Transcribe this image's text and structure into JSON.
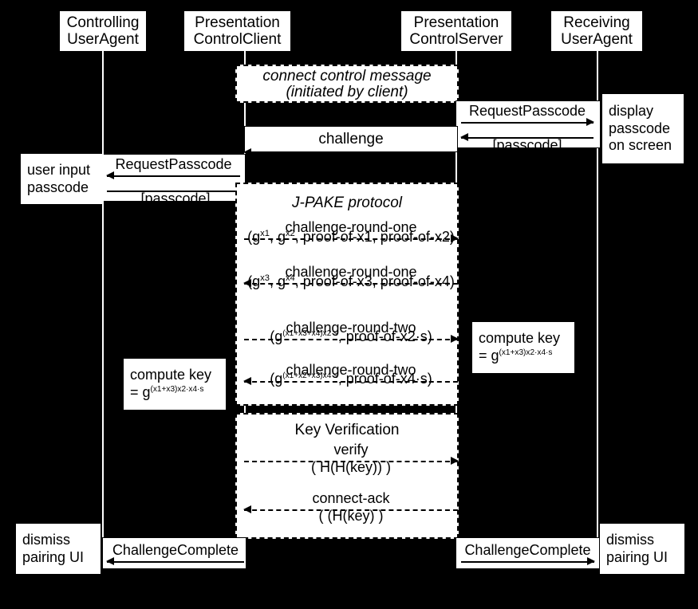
{
  "actors": [
    {
      "id": "controlling-user-agent",
      "line1": "Controlling",
      "line2": "UserAgent"
    },
    {
      "id": "presentation-control-client",
      "line1": "Presentation",
      "line2": "ControlClient"
    },
    {
      "id": "presentation-control-server",
      "line1": "Presentation",
      "line2": "ControlServer"
    },
    {
      "id": "receiving-user-agent",
      "line1": "Receiving",
      "line2": "UserAgent"
    }
  ],
  "frames": {
    "connect": {
      "title_line1": "connect control message",
      "title_line2": "(initiated by client)"
    },
    "challenge": {
      "title": "challenge"
    },
    "jpake": {
      "title": "J-PAKE protocol"
    },
    "keyverif": {
      "title": "Key Verification"
    }
  },
  "notes": {
    "display_passcode": {
      "line1": "display",
      "line2": "passcode",
      "line3": "on screen"
    },
    "user_input_passcode": {
      "line1": "user input",
      "line2": "passcode"
    },
    "compute_key_client": {
      "line1": "compute key",
      "line2_prefix": "= g",
      "line2_exp": "(x1+x3)x2·x4·s"
    },
    "compute_key_server": {
      "line1": "compute key",
      "line2_prefix": "= g",
      "line2_exp": "(x1+x3)x2·x4·s"
    },
    "dismiss_pairing_client": {
      "line1": "dismiss",
      "line2": "pairing UI"
    },
    "dismiss_pairing_server": {
      "line1": "dismiss",
      "line2": "pairing UI"
    }
  },
  "messages": {
    "request_passcode_server": {
      "label": "RequestPasscode"
    },
    "passcode_server": {
      "label": "[passcode]"
    },
    "request_passcode_client": {
      "label": "RequestPasscode"
    },
    "passcode_client": {
      "label": "[passcode]"
    },
    "challenge_round_one_a": {
      "label": "challenge-round-one",
      "payload_pre": "(g",
      "payload_exp1": "x1",
      "payload_mid": ", g",
      "payload_exp2": "x2",
      "payload_post": ", proof-of-x1, proof-of-x2)"
    },
    "challenge_round_one_b": {
      "label": "challenge-round-one",
      "payload_pre": "(g",
      "payload_exp1": "x3",
      "payload_mid": ", g",
      "payload_exp2": "x4",
      "payload_post": ", proof-of-x3, proof-of-x4)"
    },
    "challenge_round_two_a": {
      "label": "challenge-round-two",
      "payload_pre": "(g",
      "payload_exp": "(x1+x3+x4)x2·s",
      "payload_post": ", proof-of-x2·s)"
    },
    "challenge_round_two_b": {
      "label": "challenge-round-two",
      "payload_pre": "(g",
      "payload_exp": "(x1+x2+x3)x4·s",
      "payload_post": ", proof-of-x4·s)"
    },
    "verify": {
      "label": "verify",
      "payload": "( H(H(key)) )"
    },
    "connect_ack": {
      "label": "connect-ack",
      "payload": "( (H(key) )"
    },
    "challenge_complete_client": {
      "label": "ChallengeComplete"
    },
    "challenge_complete_server": {
      "label": "ChallengeComplete"
    }
  },
  "colors": {
    "background": "#000000",
    "surface": "#ffffff",
    "stroke": "#000000"
  }
}
